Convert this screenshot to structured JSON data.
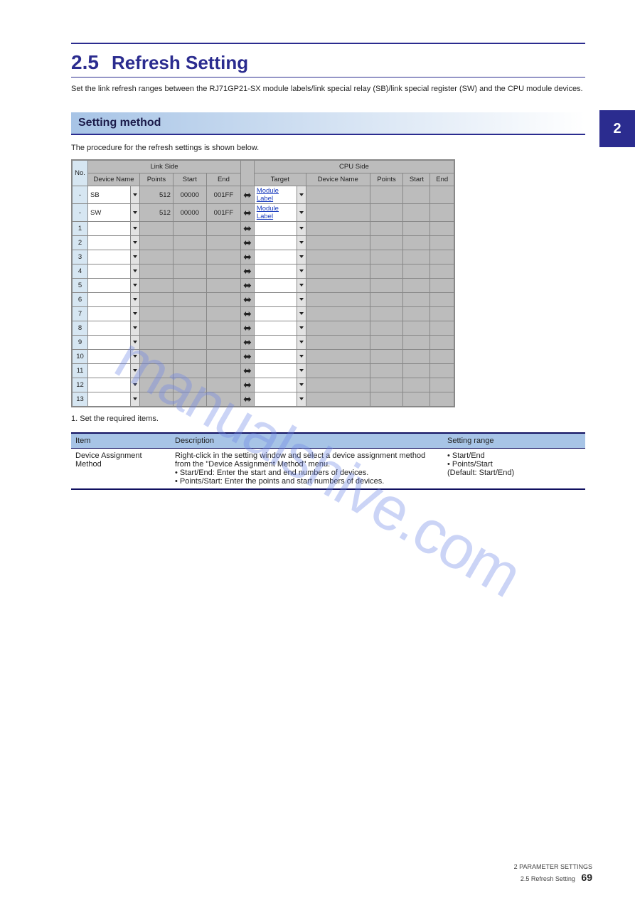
{
  "chapter_tab": "2",
  "header": {
    "section_num": "2.5",
    "section_title": "Refresh Setting"
  },
  "sub_header": "Set the link refresh ranges between the RJ71GP21-SX module labels/link special relay (SB)/link special register (SW) and the CPU module devices.",
  "grid": {
    "link_side_title": "Link Side",
    "cpu_side_title": "CPU Side",
    "columns_link": [
      "Device Name",
      "Points",
      "Start",
      "End"
    ],
    "columns_cpu": [
      "Target",
      "Device Name",
      "Points",
      "Start",
      "End"
    ],
    "row_no_head": "No.",
    "sb": {
      "no": "-",
      "dev": "SB",
      "points": "512",
      "start": "00000",
      "end": "001FF",
      "target": "Module Label"
    },
    "sw": {
      "no": "-",
      "dev": "SW",
      "points": "512",
      "start": "00000",
      "end": "001FF",
      "target": "Module Label"
    },
    "rows": [
      "1",
      "2",
      "3",
      "4",
      "5",
      "6",
      "7",
      "8",
      "9",
      "10",
      "11",
      "12",
      "13"
    ]
  },
  "param_table": {
    "headers": [
      "Item",
      "Description",
      "Setting range"
    ],
    "row": {
      "item": "Device Assignment Method",
      "desc_lines": [
        "Right-click in the setting window and select a device assignment method from the \"Device Assignment Method\" menu.",
        "• Start/End: Enter the start and end numbers of devices.",
        "• Points/Start: Enter the points and start numbers of devices."
      ],
      "range_lines": [
        "• Start/End",
        "• Points/Start",
        "(Default: Start/End)"
      ]
    }
  },
  "watermark": "manualshive.com",
  "footer": {
    "line1": "2 PARAMETER SETTINGS",
    "line2": "2.5 Refresh Setting",
    "page": "69"
  }
}
